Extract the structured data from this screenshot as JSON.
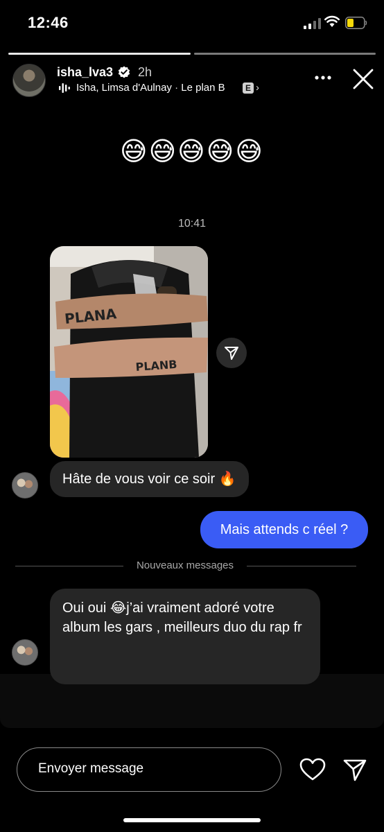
{
  "status_bar": {
    "time": "12:46"
  },
  "story_header": {
    "username": "isha_lva3",
    "time_ago": "2h",
    "music_artists": "Isha, Limsa d'Aulnay",
    "music_sep": " · ",
    "music_title": "Le plan B",
    "explicit_badge": "E",
    "chevron": "›"
  },
  "caption": {
    "text": "😅😅😅😅😅"
  },
  "dm_screenshot": {
    "timestamp": "10:41",
    "messages": [
      {
        "sender": "other",
        "text": "Hâte de vous voir ce soir 🔥"
      },
      {
        "sender": "me",
        "text": "Mais attends c réel ?"
      },
      {
        "sender": "other",
        "text": "Oui oui 😂j’ai vraiment adoré votre album les gars , meilleurs duo du rap fr"
      }
    ],
    "divider_label": "Nouveaux messages",
    "photo_text_1": "PLANA",
    "photo_text_2": "PLANB"
  },
  "footer": {
    "reply_placeholder": "Envoyer message"
  },
  "colors": {
    "accent_blue": "#3a5cf5",
    "battery_yellow": "#f5d90a"
  }
}
